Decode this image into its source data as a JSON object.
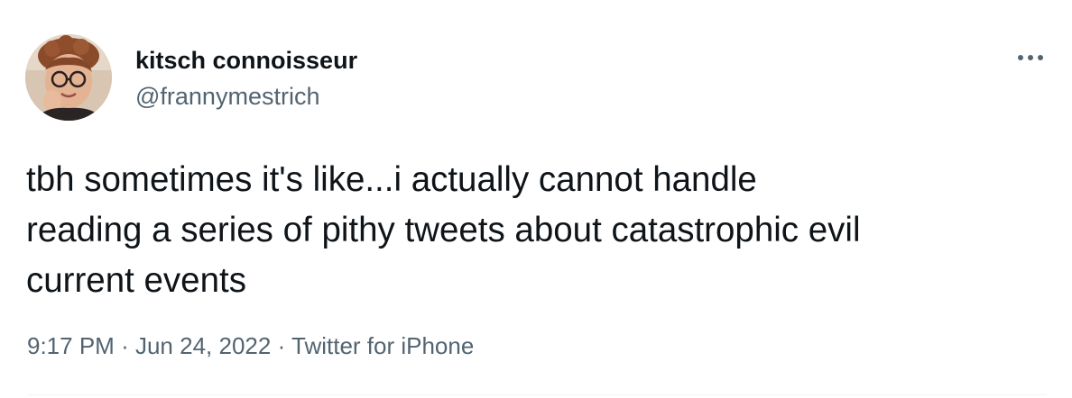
{
  "tweet": {
    "author": {
      "display_name": "kitsch connoisseur",
      "handle": "@frannymestrich",
      "avatar_icon": "profile-photo"
    },
    "more_icon": "more-horizontal-icon",
    "text": "tbh sometimes it's like...i actually cannot handle\nreading a series of pithy tweets about catastrophic evil\ncurrent events",
    "meta": {
      "time": "9:17 PM",
      "separator": "·",
      "date": "Jun 24, 2022",
      "source": "Twitter for iPhone"
    }
  },
  "colors": {
    "text_primary": "#0f1419",
    "text_secondary": "#536471",
    "divider": "#eff3f4",
    "background": "#ffffff"
  }
}
